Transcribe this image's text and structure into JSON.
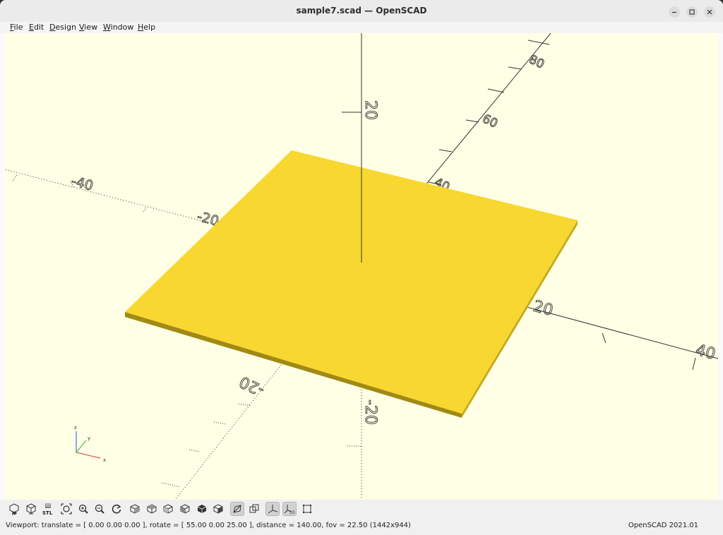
{
  "window": {
    "title": "sample7.scad — OpenSCAD"
  },
  "menubar": {
    "items": [
      {
        "label": "File",
        "mnemonic": "F",
        "rest": "ile"
      },
      {
        "label": "Edit",
        "mnemonic": "E",
        "rest": "dit"
      },
      {
        "label": "Design",
        "mnemonic": "D",
        "rest": "esign"
      },
      {
        "label": "View",
        "mnemonic": "V",
        "rest": "iew"
      },
      {
        "label": "Window",
        "mnemonic": "W",
        "rest": "indow"
      },
      {
        "label": "Help",
        "mnemonic": "H",
        "rest": "elp"
      }
    ]
  },
  "viewport": {
    "background": "#ffffe5",
    "object_color": "#f8d731",
    "axis_labels": {
      "x_pos": "20",
      "x_pos2": "40",
      "x_neg1": "-20",
      "x_neg2": "-40",
      "y_pos1": "40",
      "y_pos2": "60",
      "y_pos3": "80",
      "y_neg": "-20",
      "z_pos": "20",
      "z_neg": "-20"
    },
    "axes_gizmo": {
      "x": "x",
      "y": "y",
      "z": "z"
    }
  },
  "toolbar": {
    "buttons": [
      {
        "name": "preview",
        "icon": "preview-icon"
      },
      {
        "name": "render",
        "icon": "render-icon"
      },
      {
        "name": "export-stl",
        "icon": "stl-export-icon"
      },
      {
        "name": "view-all",
        "icon": "view-all-icon"
      },
      {
        "name": "zoom-in",
        "icon": "zoom-in-icon"
      },
      {
        "name": "zoom-out",
        "icon": "zoom-out-icon"
      },
      {
        "name": "reset-view",
        "icon": "reset-view-icon"
      },
      {
        "name": "view-right",
        "icon": "view-right-icon"
      },
      {
        "name": "view-top",
        "icon": "view-top-icon"
      },
      {
        "name": "view-bottom",
        "icon": "view-bottom-icon"
      },
      {
        "name": "view-left",
        "icon": "view-left-icon"
      },
      {
        "name": "view-front",
        "icon": "view-front-icon"
      },
      {
        "name": "view-back",
        "icon": "view-back-icon"
      },
      {
        "name": "perspective",
        "icon": "perspective-icon",
        "active": true
      },
      {
        "name": "orthogonal",
        "icon": "orthogonal-icon"
      },
      {
        "name": "show-axes",
        "icon": "show-axes-icon",
        "active": true
      },
      {
        "name": "show-scale",
        "icon": "show-scale-icon",
        "active": true,
        "text": "10"
      },
      {
        "name": "show-edges",
        "icon": "show-edges-icon"
      }
    ],
    "stl_label": "STL"
  },
  "status": {
    "viewport_text": "Viewport: translate = [ 0.00 0.00 0.00 ], rotate = [ 55.00 0.00 25.00 ], distance = 140.00, fov = 22.50 (1442x944)",
    "version": "OpenSCAD 2021.01"
  }
}
